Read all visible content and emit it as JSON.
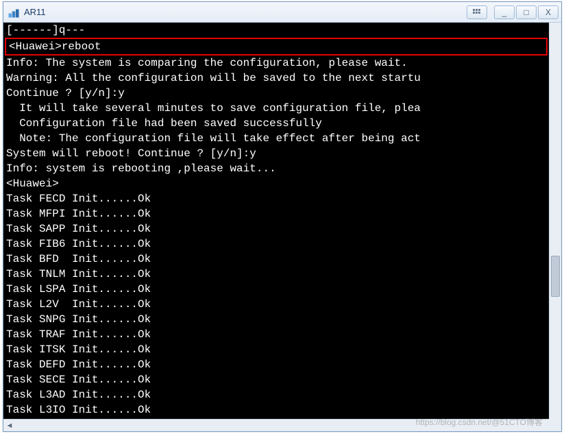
{
  "window": {
    "title": "AR11",
    "controls": {
      "grid_tip": "Grid",
      "minimize": "_",
      "maximize": "□",
      "close": "X"
    }
  },
  "highlighted_command": "<Huawei>reboot",
  "terminal_lines_before": [
    "[------]q---"
  ],
  "terminal_lines_after": [
    "Info: The system is comparing the configuration, please wait.",
    "Warning: All the configuration will be saved to the next startu",
    "Continue ? [y/n]:y",
    "  It will take several minutes to save configuration file, plea",
    "  Configuration file had been saved successfully",
    "  Note: The configuration file will take effect after being act",
    "System will reboot! Continue ? [y/n]:y",
    "Info: system is rebooting ,please wait...",
    "<Huawei>",
    "Task FECD Init......Ok",
    "Task MFPI Init......Ok",
    "Task SAPP Init......Ok",
    "Task FIB6 Init......Ok",
    "Task BFD  Init......Ok",
    "Task TNLM Init......Ok",
    "Task LSPA Init......Ok",
    "Task L2V  Init......Ok",
    "Task SNPG Init......Ok",
    "Task TRAF Init......Ok",
    "Task ITSK Init......Ok",
    "Task DEFD Init......Ok",
    "Task SECE Init......Ok",
    "Task L3AD Init......Ok",
    "Task L3IO Init......Ok"
  ],
  "watermark": "https://blog.csdn.net/@51CTO博客"
}
